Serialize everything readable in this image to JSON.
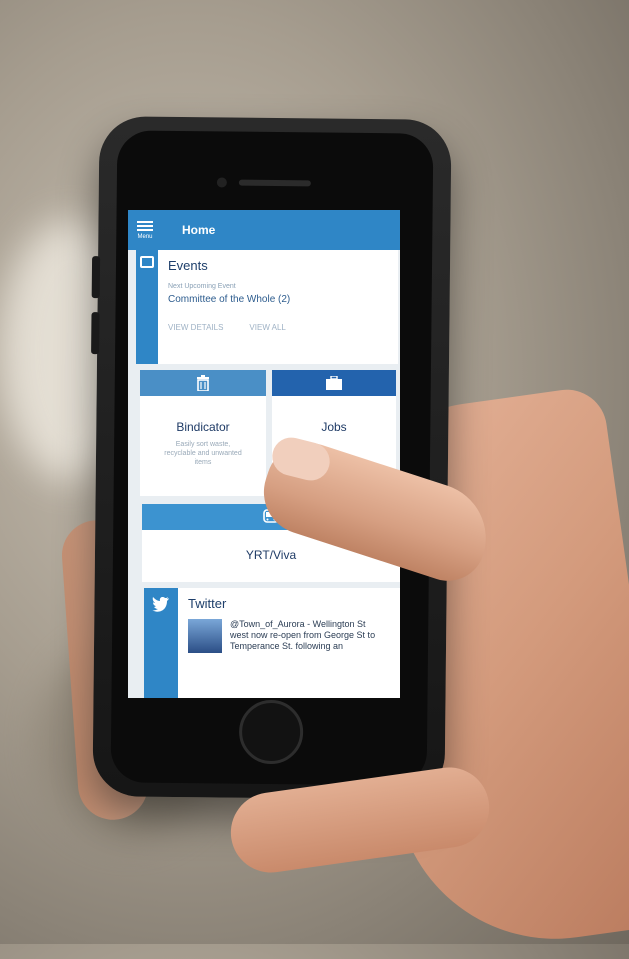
{
  "screen": {
    "menu_label": "Menu",
    "title": "Home"
  },
  "events": {
    "title": "Events",
    "subtitle": "Next Upcoming Event",
    "event_name": "Committee of the Whole (2)",
    "view_details": "VIEW DETAILS",
    "view_all": "VIEW ALL"
  },
  "tiles": {
    "bindicator_title": "Bindicator",
    "bindicator_desc": "Easily sort waste, recyclable and unwanted items",
    "jobs_title": "Jobs",
    "yrt_title": "YRT/Viva"
  },
  "twitter": {
    "title": "Twitter",
    "tweet": "@Town_of_Aurora - Wellington St west now re-open from George St to Temperance St. following an"
  },
  "colors": {
    "accent_blue": "#2f86c6",
    "dark_blue": "#2363ad",
    "text_navy": "#1f3b66"
  },
  "icons": {
    "menu": "hamburger-icon",
    "events": "calendar-icon",
    "bindicator": "trash-icon",
    "jobs": "briefcase-icon",
    "yrt": "bus-icon",
    "twitter": "twitter-bird-icon"
  }
}
